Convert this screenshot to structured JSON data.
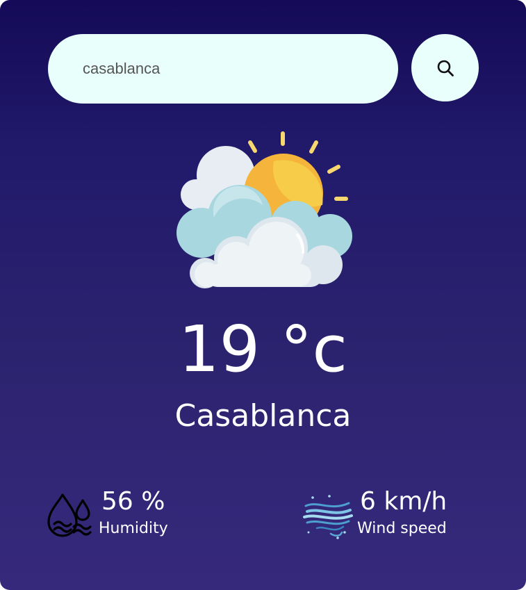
{
  "search": {
    "value": "casablanca",
    "button_icon": "search-icon"
  },
  "weather": {
    "condition_icon": "partly-cloudy-sun-icon",
    "temperature": "19 °c",
    "city": "Casablanca"
  },
  "details": {
    "humidity": {
      "icon": "humidity-icon",
      "value": "56 %",
      "label": "Humidity"
    },
    "wind": {
      "icon": "wind-icon",
      "value": "6 km/h",
      "label": "Wind speed"
    }
  },
  "colors": {
    "background_top": "#140a57",
    "background_bottom": "#36297c",
    "input_background": "#e9fffb",
    "text": "#ffffff"
  }
}
